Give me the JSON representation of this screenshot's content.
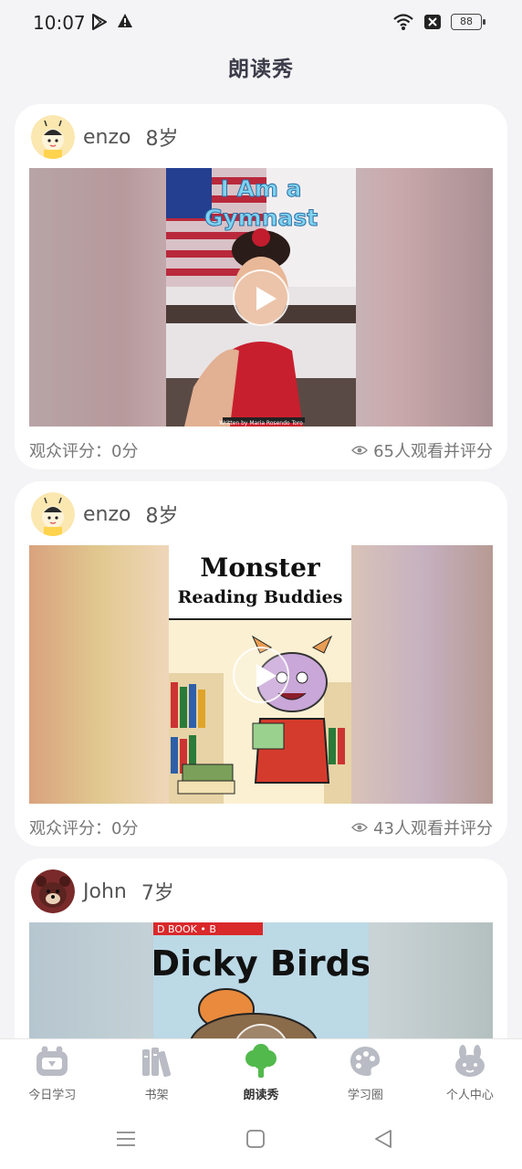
{
  "status_bar": {
    "time": "10:07",
    "battery": "88"
  },
  "header": {
    "title": "朗读秀"
  },
  "feed": [
    {
      "user": {
        "name": "enzo",
        "age": "8岁"
      },
      "video": {
        "title_line1": "I Am a",
        "title_line2": "Gymnast",
        "credit": "Written by Maria Rosendo Toro"
      },
      "score": "观众评分：0分",
      "views": "65人观看并评分"
    },
    {
      "user": {
        "name": "enzo",
        "age": "8岁"
      },
      "video": {
        "title_line1": "Monster",
        "title_line2": "Reading Buddies"
      },
      "score": "观众评分：0分",
      "views": "43人观看并评分"
    },
    {
      "user": {
        "name": "John",
        "age": "7岁"
      },
      "video": {
        "banner": "D BOOK • B",
        "title_line1": "Dicky Birds"
      }
    }
  ],
  "bottom_nav": {
    "items": [
      {
        "label": "今日学习",
        "icon": "tv-icon"
      },
      {
        "label": "书架",
        "icon": "books-icon"
      },
      {
        "label": "朗读秀",
        "icon": "tree-icon",
        "active": true
      },
      {
        "label": "学习圈",
        "icon": "palette-icon"
      },
      {
        "label": "个人中心",
        "icon": "bunny-icon"
      }
    ]
  },
  "colors": {
    "active": "#52b94c",
    "inactive": "#b9bcc4",
    "accent_play": "#ffffff"
  }
}
